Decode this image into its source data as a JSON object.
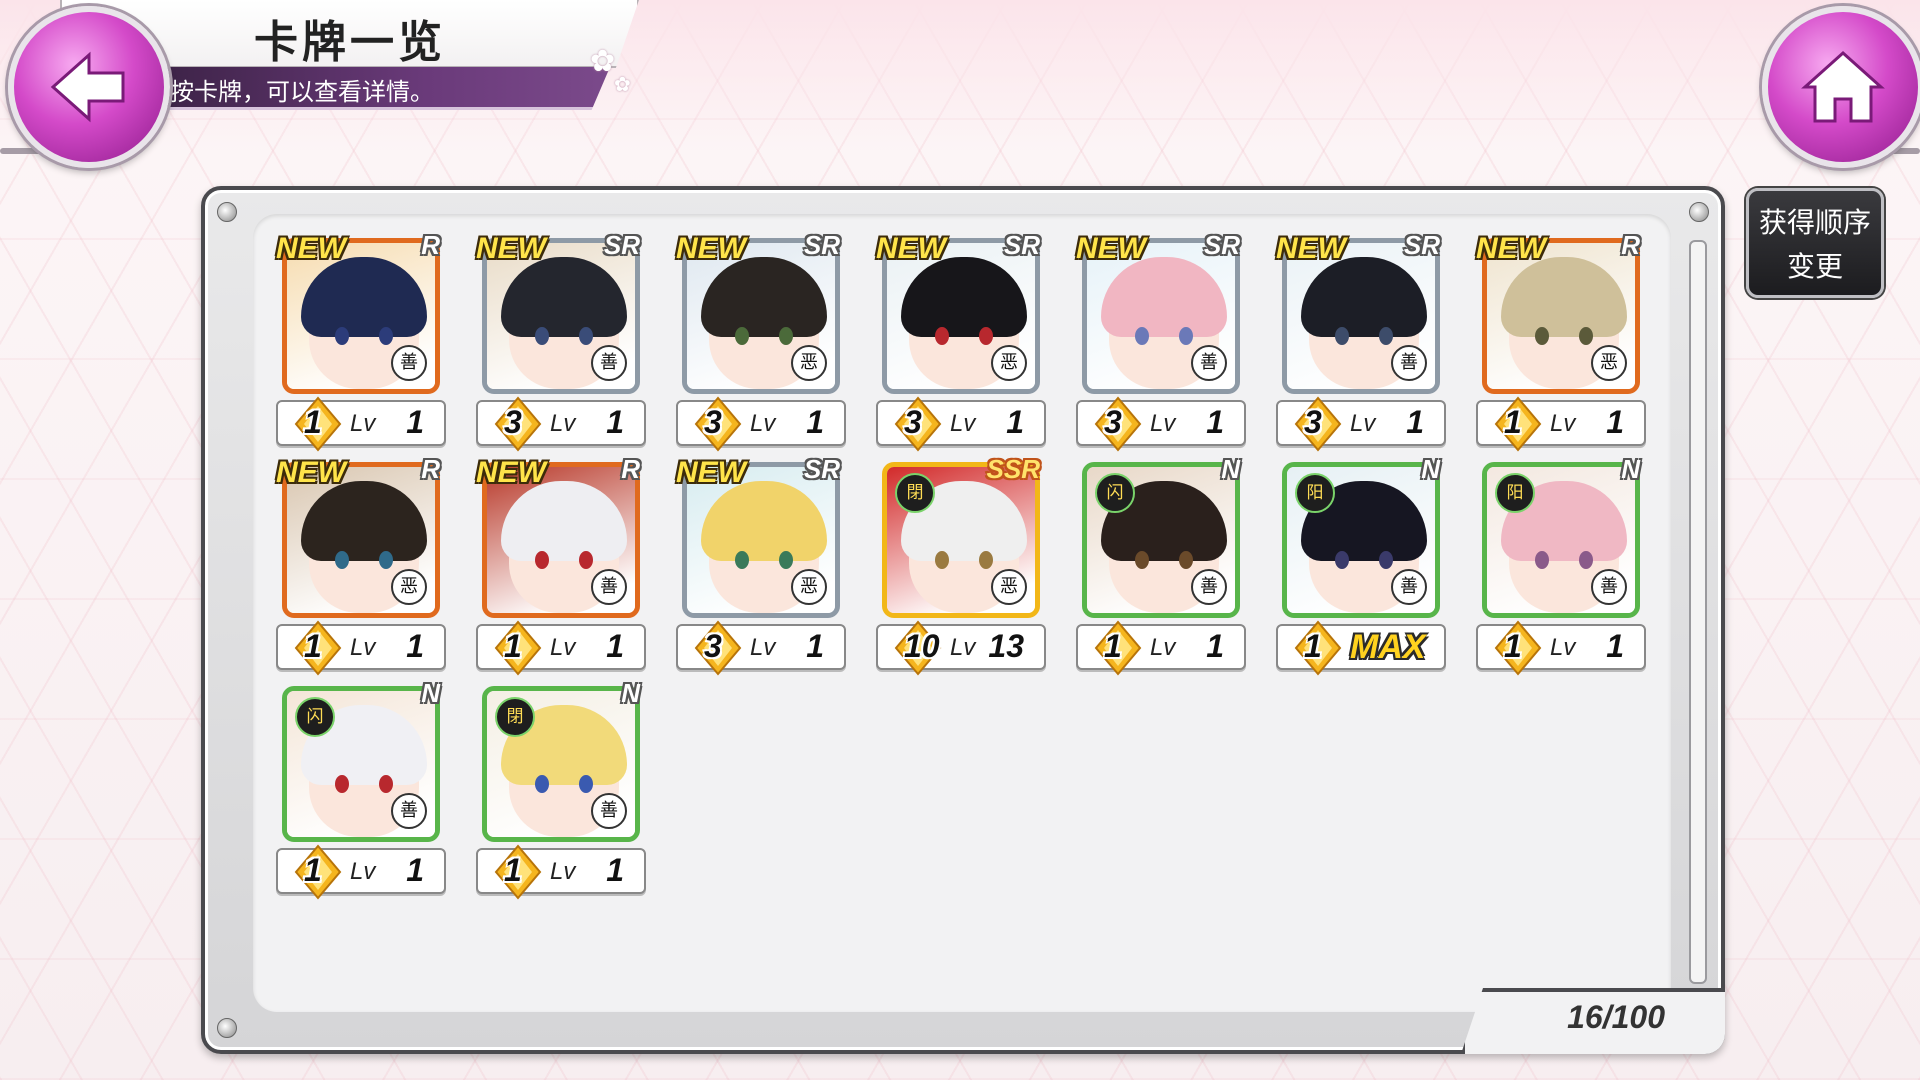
{
  "header": {
    "title": "卡牌一览",
    "subtitle": "按卡牌，可以查看详情。",
    "back_icon": "back-arrow-icon",
    "home_icon": "home-icon"
  },
  "sort_button": {
    "label_line1": "获得顺序",
    "label_line2": "变更"
  },
  "counter": "16/100",
  "colors": {
    "frame_R": "#e06a1e",
    "frame_SR": "#8e9aa6",
    "frame_SSR": "#f2b718",
    "frame_N": "#58b54a",
    "new_tag": "#ffe44a",
    "button_magenta": "#d44ac9"
  },
  "cards": [
    {
      "new": "NEW",
      "rarity": "R",
      "rank": "1",
      "lv_label": "Lv",
      "lv": "1",
      "badge": "善",
      "hair": "#1f2a52",
      "eye": "#2c3c7a",
      "bg": "#f6dcb0"
    },
    {
      "new": "NEW",
      "rarity": "SR",
      "rank": "3",
      "lv_label": "Lv",
      "lv": "1",
      "badge": "善",
      "hair": "#24262e",
      "eye": "#3a4c78",
      "bg": "#e9dcc8"
    },
    {
      "new": "NEW",
      "rarity": "SR",
      "rank": "3",
      "lv_label": "Lv",
      "lv": "1",
      "badge": "恶",
      "hair": "#2a2522",
      "eye": "#4b6a3a",
      "bg": "#dfe8f0"
    },
    {
      "new": "NEW",
      "rarity": "SR",
      "rank": "3",
      "lv_label": "Lv",
      "lv": "1",
      "badge": "恶",
      "hair": "#17161a",
      "eye": "#b8282e",
      "bg": "#eaf1f4"
    },
    {
      "new": "NEW",
      "rarity": "SR",
      "rank": "3",
      "lv_label": "Lv",
      "lv": "1",
      "badge": "善",
      "hair": "#f1b6c2",
      "eye": "#6b79b8",
      "bg": "#e6f2f8"
    },
    {
      "new": "NEW",
      "rarity": "SR",
      "rank": "3",
      "lv_label": "Lv",
      "lv": "1",
      "badge": "善",
      "hair": "#1c1e26",
      "eye": "#3d4c6a",
      "bg": "#eaf2f6"
    },
    {
      "new": "NEW",
      "rarity": "R",
      "rank": "1",
      "lv_label": "Lv",
      "lv": "1",
      "badge": "恶",
      "hair": "#cfc09a",
      "eye": "#5b5a3a",
      "bg": "#efe4cf"
    },
    {
      "new": "NEW",
      "rarity": "R",
      "rank": "1",
      "lv_label": "Lv",
      "lv": "1",
      "badge": "恶",
      "hair": "#2c241e",
      "eye": "#2f6a8a",
      "bg": "#d9c6b0"
    },
    {
      "new": "NEW",
      "rarity": "R",
      "rank": "1",
      "lv_label": "Lv",
      "lv": "1",
      "badge": "善",
      "hair": "#eeeef2",
      "eye": "#b8282e",
      "bg": "#b8392a"
    },
    {
      "new": "NEW",
      "rarity": "SR",
      "rank": "3",
      "lv_label": "Lv",
      "lv": "1",
      "badge": "恶",
      "hair": "#f1d36a",
      "eye": "#3a7a5a",
      "bg": "#d7ecf0"
    },
    {
      "new": "",
      "rarity": "SSR",
      "rank": "10",
      "lv_label": "Lv",
      "lv": "13",
      "badge": "恶",
      "faction": "閉",
      "hair": "#efefef",
      "eye": "#9a7a40",
      "bg": "#d22a2a"
    },
    {
      "new": "",
      "rarity": "N",
      "rank": "1",
      "lv_label": "Lv",
      "lv": "1",
      "badge": "善",
      "faction": "闪",
      "hair": "#2a201c",
      "eye": "#6a4a2a",
      "bg": "#e8d8c8"
    },
    {
      "new": "",
      "rarity": "N",
      "rank": "1",
      "lv_label": "",
      "lv": "MAX",
      "badge": "善",
      "faction": "阳",
      "hair": "#161622",
      "eye": "#3a3a6a",
      "bg": "#e6f0f4"
    },
    {
      "new": "",
      "rarity": "N",
      "rank": "1",
      "lv_label": "Lv",
      "lv": "1",
      "badge": "善",
      "faction": "阳",
      "hair": "#f0b8c4",
      "eye": "#8a5a8a",
      "bg": "#f3e8e0"
    },
    {
      "new": "",
      "rarity": "N",
      "rank": "1",
      "lv_label": "Lv",
      "lv": "1",
      "badge": "善",
      "faction": "闪",
      "hair": "#f0f0f4",
      "eye": "#b8282e",
      "bg": "#f4e6d8"
    },
    {
      "new": "",
      "rarity": "N",
      "rank": "1",
      "lv_label": "Lv",
      "lv": "1",
      "badge": "善",
      "faction": "閉",
      "hair": "#f2da7a",
      "eye": "#3a5ab0",
      "bg": "#f4efe4"
    }
  ]
}
